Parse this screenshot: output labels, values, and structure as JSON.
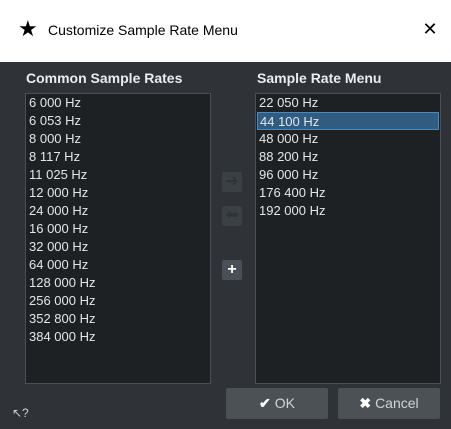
{
  "window": {
    "title": "Customize Sample Rate Menu",
    "icon": "star-icon",
    "close": "✕"
  },
  "left_list": {
    "heading": "Common Sample Rates",
    "items": [
      "6 000 Hz",
      "6 053 Hz",
      "8 000 Hz",
      "8 117 Hz",
      "11 025 Hz",
      "12 000 Hz",
      "24 000 Hz",
      "16 000 Hz",
      "32 000 Hz",
      "64 000 Hz",
      "128 000 Hz",
      "256 000 Hz",
      "352 800 Hz",
      "384 000 Hz"
    ]
  },
  "right_list": {
    "heading": "Sample Rate Menu",
    "items": [
      "22 050 Hz",
      "44 100 Hz",
      "48 000 Hz",
      "88 200 Hz",
      "96 000 Hz",
      "176 400 Hz",
      "192 000 Hz"
    ],
    "selected": "44 100 Hz"
  },
  "buttons": {
    "move_right": "➜",
    "move_left": "⬅",
    "add": "+",
    "ok": "OK",
    "ok_glyph": "✔",
    "cancel": "Cancel",
    "cancel_glyph": "✖",
    "help": "↖?"
  }
}
